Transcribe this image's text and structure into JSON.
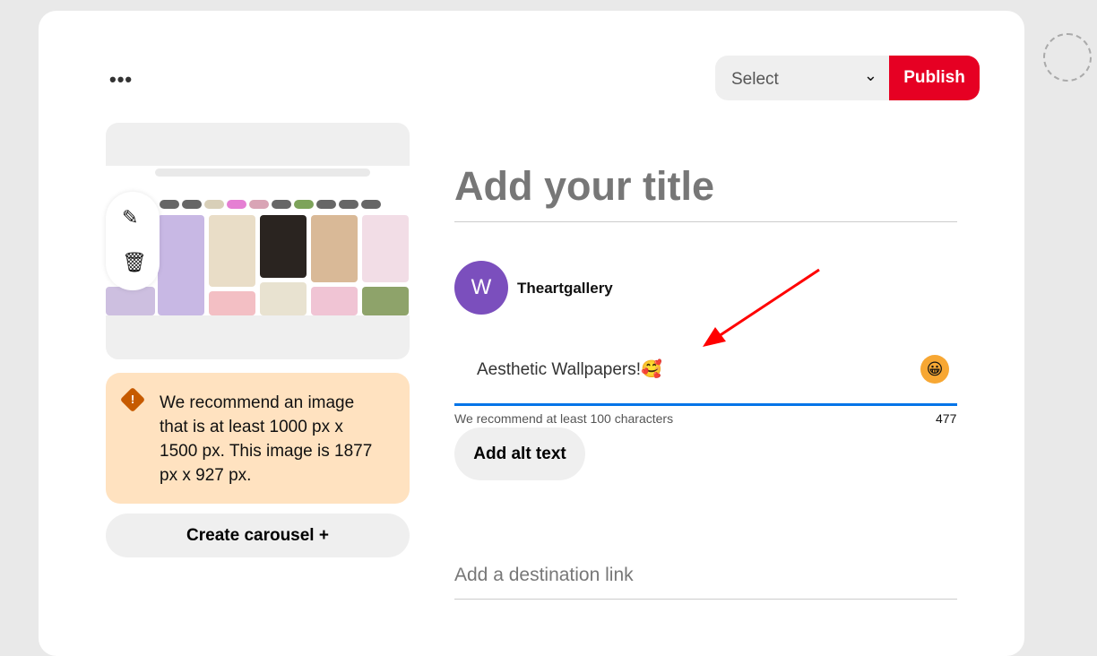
{
  "toolbar": {
    "more_icon": "•••",
    "select_label": "Select",
    "publish_label": "Publish"
  },
  "image_tools": {
    "edit_icon": "pencil-icon",
    "delete_icon": "trash-icon"
  },
  "warning": {
    "text": "We recommend an image that is at least 1000 px x 1500 px. This image is 1877 px x 927 px."
  },
  "carousel": {
    "label": "Create carousel",
    "icon": "+"
  },
  "form": {
    "title_placeholder": "Add your title",
    "user": {
      "initial": "W",
      "name": "Theartgallery"
    },
    "description": "Aesthetic Wallpapers!🥰",
    "emoji_icon": "😀",
    "hint": "We recommend at least 100 characters",
    "count": "477",
    "alt_text_label": "Add alt text",
    "link_placeholder": "Add a destination link"
  },
  "colors": {
    "accent": "#e60023",
    "focus": "#0074e8",
    "warning_bg": "#ffe2c0",
    "avatar": "#7b4fbd"
  }
}
